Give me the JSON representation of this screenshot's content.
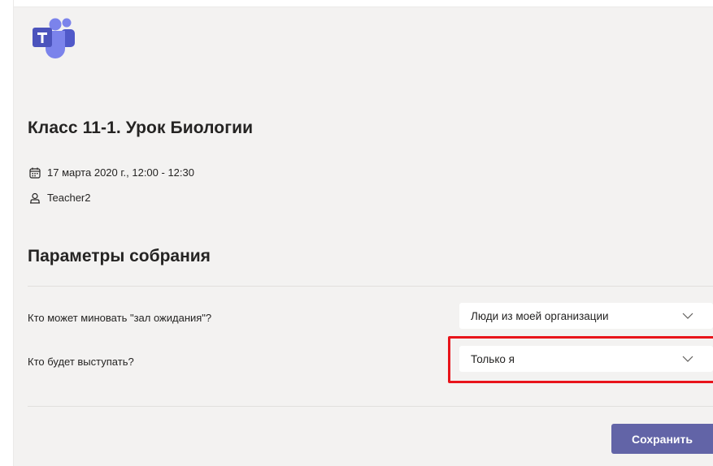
{
  "app": {
    "logo_icon": "microsoft-teams-logo",
    "brand_color": "#6264a7"
  },
  "meeting": {
    "title": "Класс 11-1. Урок Биологии",
    "date_icon": "calendar-icon",
    "datetime": "17 марта 2020 г., 12:00 - 12:30",
    "organizer_icon": "person-icon",
    "organizer": "Teacher2"
  },
  "options": {
    "section_title": "Параметры собрания",
    "bypass_lobby": {
      "label": "Кто может миновать \"зал ожидания\"?",
      "value": "Люди из моей организации"
    },
    "presenters": {
      "label": "Кто будет выступать?",
      "value": "Только я",
      "highlight_color": "#e8141b"
    },
    "save_label": "Сохранить"
  }
}
